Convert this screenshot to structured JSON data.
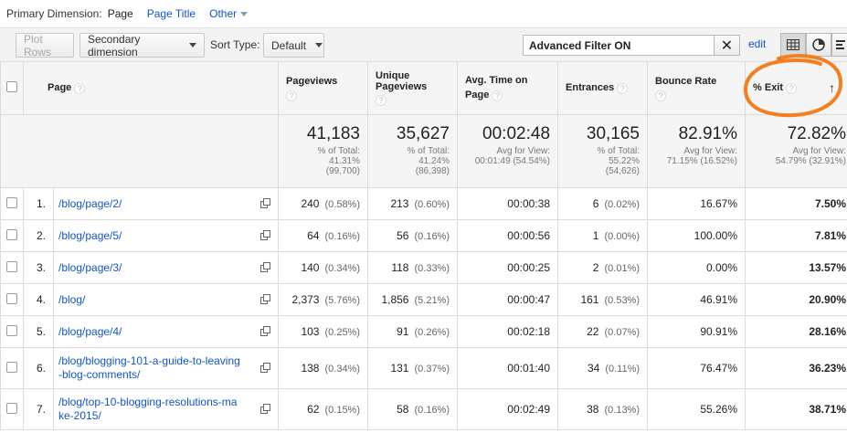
{
  "dim_bar": {
    "label": "Primary Dimension:",
    "active": "Page",
    "page_title": "Page Title",
    "other": "Other"
  },
  "toolbar": {
    "plot_rows": "Plot Rows",
    "secondary_dimension": "Secondary dimension",
    "sort_type_label": "Sort Type:",
    "sort_type_value": "Default",
    "filter_value": "Advanced Filter ON",
    "clear": "✕",
    "edit": "edit"
  },
  "columns": {
    "page": "Page",
    "pageviews": "Pageviews",
    "unique_pageviews": "Unique Pageviews",
    "avg_time_l1": "Avg. Time on",
    "avg_time_l2": "Page",
    "entrances": "Entrances",
    "bounce_rate": "Bounce Rate",
    "exit": "% Exit",
    "help": "?"
  },
  "totals": {
    "pageviews": {
      "value": "41,183",
      "l1": "% of Total:",
      "l2": "41.31%",
      "l3": "(99,700)"
    },
    "unique": {
      "value": "35,627",
      "l1": "% of Total:",
      "l2": "41.24%",
      "l3": "(86,398)"
    },
    "avg_time": {
      "value": "00:02:48",
      "l1": "Avg for View:",
      "l2": "00:01:49 (54.54%)"
    },
    "entrances": {
      "value": "30,165",
      "l1": "% of Total:",
      "l2": "55.22%",
      "l3": "(54,626)"
    },
    "bounce": {
      "value": "82.91%",
      "l1": "Avg for View:",
      "l2": "71.15% (16.52%)"
    },
    "exit": {
      "value": "72.82%",
      "l1": "Avg for View:",
      "l2": "54.79% (32.91%)"
    }
  },
  "rows": [
    {
      "rank": "1.",
      "page": "/blog/page/2/",
      "pv": "240",
      "pv_pct": "(0.58%)",
      "upv": "213",
      "upv_pct": "(0.60%)",
      "time": "00:00:38",
      "ent": "6",
      "ent_pct": "(0.02%)",
      "bounce": "16.67%",
      "exit": "7.50%"
    },
    {
      "rank": "2.",
      "page": "/blog/page/5/",
      "pv": "64",
      "pv_pct": "(0.16%)",
      "upv": "56",
      "upv_pct": "(0.16%)",
      "time": "00:00:56",
      "ent": "1",
      "ent_pct": "(0.00%)",
      "bounce": "100.00%",
      "exit": "7.81%"
    },
    {
      "rank": "3.",
      "page": "/blog/page/3/",
      "pv": "140",
      "pv_pct": "(0.34%)",
      "upv": "118",
      "upv_pct": "(0.33%)",
      "time": "00:00:25",
      "ent": "2",
      "ent_pct": "(0.01%)",
      "bounce": "0.00%",
      "exit": "13.57%"
    },
    {
      "rank": "4.",
      "page": "/blog/",
      "pv": "2,373",
      "pv_pct": "(5.76%)",
      "upv": "1,856",
      "upv_pct": "(5.21%)",
      "time": "00:00:47",
      "ent": "161",
      "ent_pct": "(0.53%)",
      "bounce": "46.91%",
      "exit": "20.90%"
    },
    {
      "rank": "5.",
      "page": "/blog/page/4/",
      "pv": "103",
      "pv_pct": "(0.25%)",
      "upv": "91",
      "upv_pct": "(0.26%)",
      "time": "00:02:18",
      "ent": "22",
      "ent_pct": "(0.07%)",
      "bounce": "90.91%",
      "exit": "28.16%"
    },
    {
      "rank": "6.",
      "page_l1": "/blog/blogging-101-a-guide-to-leaving",
      "page_l2": "-blog-comments/",
      "pv": "138",
      "pv_pct": "(0.34%)",
      "upv": "131",
      "upv_pct": "(0.37%)",
      "time": "00:01:40",
      "ent": "34",
      "ent_pct": "(0.11%)",
      "bounce": "76.47%",
      "exit": "36.23%"
    },
    {
      "rank": "7.",
      "page_l1": "/blog/top-10-blogging-resolutions-ma",
      "page_l2": "ke-2015/",
      "pv": "62",
      "pv_pct": "(0.15%)",
      "upv": "58",
      "upv_pct": "(0.16%)",
      "time": "00:02:49",
      "ent": "38",
      "ent_pct": "(0.13%)",
      "bounce": "55.26%",
      "exit": "38.71%"
    }
  ],
  "colors": {
    "link": "#1155cc",
    "highlight_ring": "#f47f20"
  }
}
